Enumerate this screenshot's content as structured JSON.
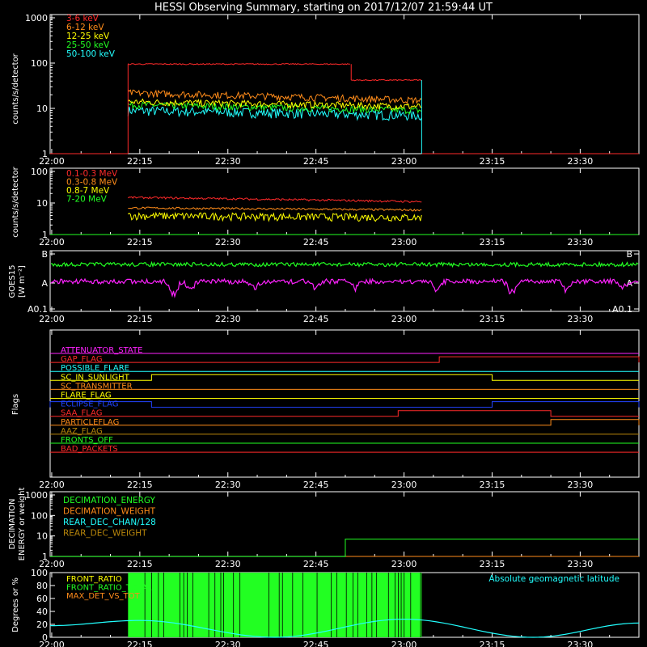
{
  "title": "HESSI Observing Summary, starting on 2017/12/07 21:59:44 UT",
  "time_ticks": [
    "22:00",
    "22:15",
    "22:30",
    "22:45",
    "23:00",
    "23:15",
    "23:30"
  ],
  "chart_data": [
    {
      "type": "line",
      "panel": "hxr",
      "ylabel": "counts/s/detector",
      "yscale": "log",
      "ylim": [
        1,
        1000
      ],
      "yticks": [
        "1",
        "10",
        "100",
        "1000"
      ],
      "xlim": [
        "21:59:44",
        "23:40:00"
      ],
      "legend_position": "top-left",
      "series": [
        {
          "name": "3-6 keV",
          "color": "#ff2a2a",
          "segments": [
            {
              "t": [
                "21:59:44",
                "22:13:00"
              ],
              "v": 1
            },
            {
              "t": [
                "22:13:00",
                "22:51:00"
              ],
              "v": 95
            },
            {
              "t": [
                "22:51:00",
                "23:03:00"
              ],
              "v": 42
            },
            {
              "t": [
                "23:03:00",
                "23:40:00"
              ],
              "v": 1
            }
          ]
        },
        {
          "name": "6-12 keV",
          "color": "#ff8c1a",
          "segments": [
            {
              "t": [
                "22:13:00",
                "23:03:00"
              ],
              "v_start": 22,
              "v_end": 15
            }
          ]
        },
        {
          "name": "12-25 keV",
          "color": "#ffff00",
          "segments": [
            {
              "t": [
                "22:13:00",
                "23:03:00"
              ],
              "v_start": 14,
              "v_end": 11
            }
          ]
        },
        {
          "name": "25-50 keV",
          "color": "#22ff22",
          "segments": [
            {
              "t": [
                "22:13:00",
                "23:03:00"
              ],
              "v_start": 12,
              "v_end": 9
            }
          ]
        },
        {
          "name": "50-100 keV",
          "color": "#22ffff",
          "segments": [
            {
              "t": [
                "21:59:44",
                "22:13:00"
              ],
              "v": 1
            },
            {
              "t": [
                "22:13:00",
                "23:03:00"
              ],
              "v_start": 9,
              "v_end": 7
            },
            {
              "t": [
                "23:03:00",
                "23:40:00"
              ],
              "v": 1
            }
          ]
        }
      ]
    },
    {
      "type": "line",
      "panel": "gamma",
      "ylabel": "counts/s/detector",
      "yscale": "log",
      "ylim": [
        1,
        100
      ],
      "yticks": [
        "1",
        "10",
        "100"
      ],
      "legend_position": "top-left",
      "series": [
        {
          "name": "0.1-0.3 MeV",
          "color": "#ff2a2a",
          "segments": [
            {
              "t": [
                "22:13:00",
                "23:03:00"
              ],
              "v_start": 15,
              "v_end": 11
            }
          ]
        },
        {
          "name": "0.3-0.8 MeV",
          "color": "#ff8c1a",
          "segments": [
            {
              "t": [
                "22:13:00",
                "23:03:00"
              ],
              "v_start": 7,
              "v_end": 6
            }
          ]
        },
        {
          "name": "0.8-7 MeV",
          "color": "#ffff00",
          "segments": [
            {
              "t": [
                "22:13:00",
                "23:03:00"
              ],
              "v_start": 4,
              "v_end": 3.5
            }
          ]
        },
        {
          "name": "7-20 MeV",
          "color": "#22ff22",
          "segments": [
            {
              "t": [
                "21:59:44",
                "23:40:00"
              ],
              "v": 1
            }
          ]
        }
      ]
    },
    {
      "type": "line",
      "panel": "goes",
      "ylabel": "GOES15",
      "ylabel2": "[W m⁻²]",
      "yticks": [
        "A0.1",
        "A",
        "B"
      ],
      "series": [
        {
          "color": "#22ff22",
          "level": "B",
          "value_note": "between A and B, near B"
        },
        {
          "color": "#ff22ff",
          "level": "A"
        }
      ]
    },
    {
      "type": "line",
      "panel": "flags",
      "ylabel": "Flags",
      "series": [
        {
          "name": "ATTENUATOR_STATE",
          "color": "#ff22ff",
          "on": []
        },
        {
          "name": "GAP_FLAG",
          "color": "#ff2a2a",
          "on": [
            [
              "23:06:00",
              "23:40:00"
            ]
          ]
        },
        {
          "name": "POSSIBLE_FLARE",
          "color": "#22ffff",
          "on": []
        },
        {
          "name": "SC_IN_SUNLIGHT",
          "color": "#ffff00",
          "on": [
            [
              "22:17:00",
              "23:15:00"
            ]
          ]
        },
        {
          "name": "SC_TRANSMITTER",
          "color": "#ff8c1a",
          "on": []
        },
        {
          "name": "FLARE_FLAG",
          "color": "#ffff00",
          "on": []
        },
        {
          "name": "ECLIPSE_FLAG",
          "color": "#2244ff",
          "on": [
            [
              "21:59:44",
              "22:17:00"
            ],
            [
              "23:15:00",
              "23:40:00"
            ]
          ]
        },
        {
          "name": "SAA_FLAG",
          "color": "#ff2a2a",
          "on": [
            [
              "22:59:00",
              "23:25:00"
            ]
          ]
        },
        {
          "name": "PARTICLEFLAG",
          "color": "#ff8c1a",
          "on": [
            [
              "23:25:00",
              "23:40:00"
            ]
          ]
        },
        {
          "name": "AAZ_FLAG",
          "color": "#b8860b",
          "on": []
        },
        {
          "name": "FRONTS_OFF",
          "color": "#22ff22",
          "on": []
        },
        {
          "name": "BAD_PACKETS",
          "color": "#ff2a2a",
          "on": []
        }
      ]
    },
    {
      "type": "line",
      "panel": "decimation",
      "ylabel": "DECIMATION",
      "ylabel2": "ENERGY or weight",
      "yscale": "log",
      "ylim": [
        1,
        1000
      ],
      "yticks": [
        "1",
        "10",
        "100",
        "1000"
      ],
      "legend_position": "top-left",
      "series": [
        {
          "name": "DECIMATION_ENERGY",
          "color": "#22ff22",
          "segments": [
            {
              "t": [
                "22:50:00",
                "23:40:00"
              ],
              "v": 7
            }
          ]
        },
        {
          "name": "DECIMATION_WEIGHT",
          "color": "#ff8c1a",
          "segments": [
            {
              "t": [
                "22:50:00",
                "23:40:00"
              ],
              "v": 1
            }
          ]
        },
        {
          "name": "REAR_DEC_CHAN/128",
          "color": "#22ffff",
          "segments": []
        },
        {
          "name": "REAR_DEC_WEIGHT",
          "color": "#b8860b",
          "segments": []
        }
      ]
    },
    {
      "type": "line",
      "panel": "ratio",
      "ylabel": "Degrees or %",
      "ylim": [
        0,
        100
      ],
      "yticks": [
        "0",
        "20",
        "40",
        "60",
        "80",
        "100"
      ],
      "legend_position": "top-left",
      "annotation": "Absolute geomagnetic latitude",
      "series": [
        {
          "name": "FRONT_RATIO",
          "color": "#ffff00"
        },
        {
          "name": "FRONT_RATIO_TOTAL",
          "color": "#22ff22",
          "segments": [
            {
              "t": [
                "22:13:00",
                "23:03:00"
              ],
              "v": 100
            }
          ]
        },
        {
          "name": "MAX_DET_VS_TOT",
          "color": "#ff8c1a"
        },
        {
          "name": "Absolute geomagnetic latitude",
          "color": "#22ffff",
          "t": [
            "21:59:44",
            "22:15:00",
            "22:38:00",
            "23:00:00",
            "23:22:00",
            "23:40:00"
          ],
          "v": [
            18,
            26,
            0,
            28,
            0,
            22
          ]
        }
      ]
    }
  ]
}
